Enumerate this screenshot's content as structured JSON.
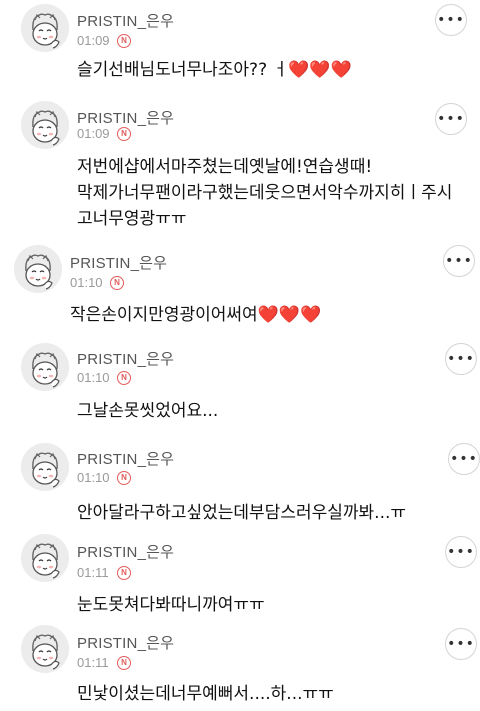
{
  "comments": [
    {
      "name": "PRISTIN_은우",
      "time": "01:09",
      "badge": "N",
      "lines": [
        "슬기선배님도너무나조아?? ㅓ"
      ],
      "hearts": "❤️❤️❤️"
    },
    {
      "name": "PRISTIN_은우",
      "time": "01:09",
      "badge": "N",
      "lines": [
        "저번에샵에서마주쳤는데옛날에!연습생때!",
        "막제가너무팬이라구했는데웃으면서악수까지히ㅣ주시",
        "고너무영광ㅠㅠ"
      ],
      "hearts": ""
    },
    {
      "name": "PRISTIN_은우",
      "time": "01:10",
      "badge": "N",
      "lines": [
        "작은손이지만영광이어써여"
      ],
      "hearts": "❤️❤️❤️"
    },
    {
      "name": "PRISTIN_은우",
      "time": "01:10",
      "badge": "N",
      "lines": [
        "그날손못씻었어요..."
      ],
      "hearts": ""
    },
    {
      "name": "PRISTIN_은우",
      "time": "01:10",
      "badge": "N",
      "lines": [
        "안아달라구하고싶었는데부담스러우실까봐...ㅠ"
      ],
      "hearts": ""
    },
    {
      "name": "PRISTIN_은우",
      "time": "01:11",
      "badge": "N",
      "lines": [
        "눈도못쳐다봐따니까여ㅠㅠ"
      ],
      "hearts": ""
    },
    {
      "name": "PRISTIN_은우",
      "time": "01:11",
      "badge": "N",
      "lines": [
        "민낯이셨는데너무예뻐서....하...ㅠㅠ"
      ],
      "hearts": ""
    }
  ],
  "more_label": "•••"
}
